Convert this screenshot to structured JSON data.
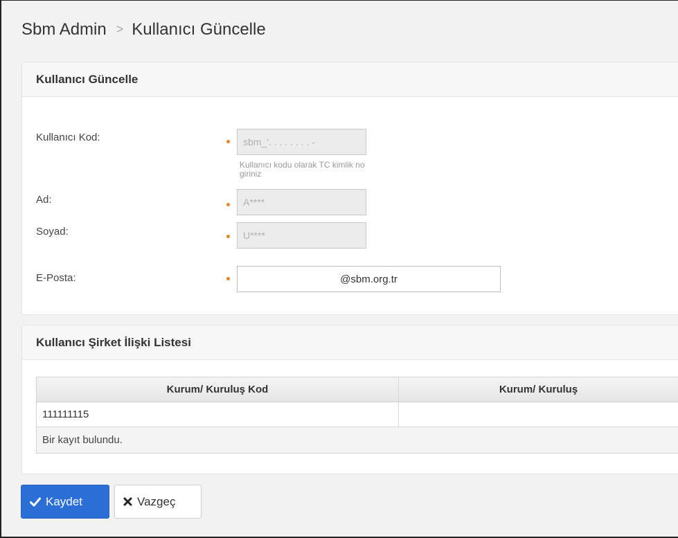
{
  "breadcrumb": {
    "root": "Sbm Admin",
    "separator": ">",
    "current": "Kullanıcı Güncelle"
  },
  "user_panel": {
    "title": "Kullanıcı Güncelle",
    "fields": {
      "code": {
        "label": "Kullanıcı Kod:",
        "value": "sbm_'. . . . . . . . -",
        "hint": "Kullanıcı kodu olarak TC kimlik no giriniz"
      },
      "name": {
        "label": "Ad:",
        "value": "A****"
      },
      "surname": {
        "label": "Soyad:",
        "value": "U****"
      },
      "email": {
        "label": "E-Posta:",
        "value": "@sbm.org.tr"
      }
    }
  },
  "company_panel": {
    "title": "Kullanıcı Şirket İlişki Listesi",
    "columns": [
      "Kurum/ Kuruluş Kod",
      "Kurum/ Kuruluş"
    ],
    "rows": [
      [
        "111111115",
        ""
      ]
    ],
    "footer": "Bir kayıt bulundu."
  },
  "actions": {
    "save_label": "Kaydet",
    "cancel_label": "Vazgeç"
  },
  "colors": {
    "primary": "#2b6fd6",
    "required": "#e0862b"
  },
  "icons": {
    "save": "check-icon",
    "cancel": "x-icon"
  }
}
